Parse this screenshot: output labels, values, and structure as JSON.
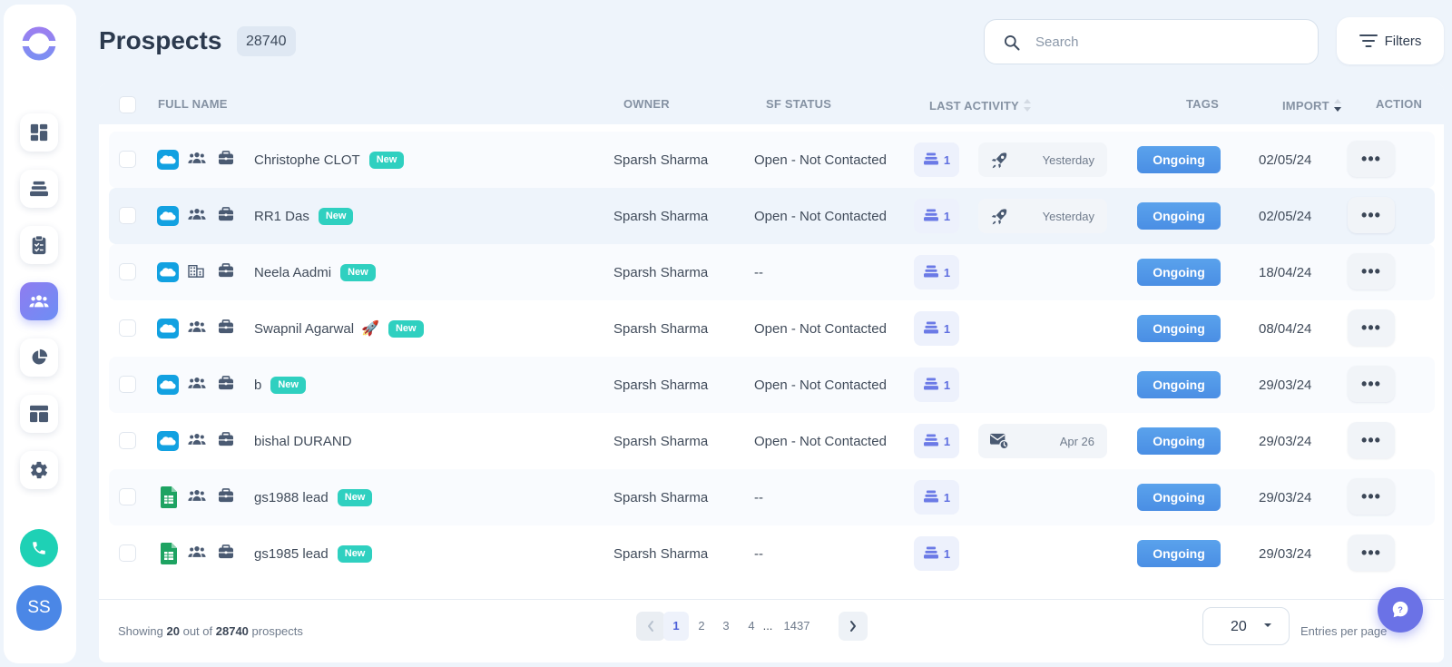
{
  "page": {
    "title": "Prospects",
    "total_count": "28740",
    "search_placeholder": "Search",
    "filters_label": "Filters"
  },
  "sidebar": {
    "items": [
      {
        "icon": "dashboard-icon",
        "active": false
      },
      {
        "icon": "sequences-icon",
        "active": false
      },
      {
        "icon": "tasks-icon",
        "active": false
      },
      {
        "icon": "prospects-icon",
        "active": true
      },
      {
        "icon": "reports-icon",
        "active": false
      },
      {
        "icon": "templates-icon",
        "active": false
      },
      {
        "icon": "settings-icon",
        "active": false
      }
    ],
    "phone_icon": "phone-icon",
    "avatar_initials": "SS"
  },
  "table": {
    "headers": {
      "full_name": "FULL NAME",
      "owner": "OWNER",
      "sf_status": "SF STATUS",
      "last_activity": "LAST ACTIVITY",
      "tags": "TAGS",
      "import": "IMPORT",
      "action": "ACTION"
    },
    "rows": [
      {
        "source": "salesforce",
        "type": "people",
        "name": "Christophe CLOT",
        "rocket": false,
        "badge": "New",
        "owner": "Sparsh Sharma",
        "sf_status": "Open - Not Contacted",
        "sequences": "1",
        "activity_icon": "rocket",
        "activity": "Yesterday",
        "tag": "Ongoing",
        "import": "02/05/24",
        "action": "•••"
      },
      {
        "source": "salesforce",
        "type": "people",
        "name": "RR1 Das",
        "rocket": false,
        "badge": "New",
        "owner": "Sparsh Sharma",
        "sf_status": "Open - Not Contacted",
        "sequences": "1",
        "activity_icon": "rocket",
        "activity": "Yesterday",
        "tag": "Ongoing",
        "import": "02/05/24",
        "action": "•••"
      },
      {
        "source": "salesforce",
        "type": "building",
        "name": "Neela Aadmi",
        "rocket": false,
        "badge": "New",
        "owner": "Sparsh Sharma",
        "sf_status": "--",
        "sequences": "1",
        "activity_icon": "",
        "activity": "",
        "tag": "Ongoing",
        "import": "18/04/24",
        "action": "•••"
      },
      {
        "source": "salesforce",
        "type": "people",
        "name": "Swapnil Agarwal",
        "rocket": true,
        "badge": "New",
        "owner": "Sparsh Sharma",
        "sf_status": "Open - Not Contacted",
        "sequences": "1",
        "activity_icon": "",
        "activity": "",
        "tag": "Ongoing",
        "import": "08/04/24",
        "action": "•••"
      },
      {
        "source": "salesforce",
        "type": "people",
        "name": "b",
        "rocket": false,
        "badge": "New",
        "owner": "Sparsh Sharma",
        "sf_status": "Open - Not Contacted",
        "sequences": "1",
        "activity_icon": "",
        "activity": "",
        "tag": "Ongoing",
        "import": "29/03/24",
        "action": "•••"
      },
      {
        "source": "salesforce",
        "type": "people",
        "name": "bishal DURAND",
        "rocket": false,
        "badge": "",
        "owner": "Sparsh Sharma",
        "sf_status": "Open - Not Contacted",
        "sequences": "1",
        "activity_icon": "mail",
        "activity": "Apr 26",
        "tag": "Ongoing",
        "import": "29/03/24",
        "action": "•••"
      },
      {
        "source": "sheets",
        "type": "people",
        "name": "gs1988 lead",
        "rocket": false,
        "badge": "New",
        "owner": "Sparsh Sharma",
        "sf_status": "--",
        "sequences": "1",
        "activity_icon": "",
        "activity": "",
        "tag": "Ongoing",
        "import": "29/03/24",
        "action": "•••"
      },
      {
        "source": "sheets",
        "type": "people",
        "name": "gs1985 lead",
        "rocket": false,
        "badge": "New",
        "owner": "Sparsh Sharma",
        "sf_status": "--",
        "sequences": "1",
        "activity_icon": "",
        "activity": "",
        "tag": "Ongoing",
        "import": "29/03/24",
        "action": "•••"
      }
    ]
  },
  "footer": {
    "showing_prefix": "Showing",
    "showing_count": "20",
    "showing_mid": "out of",
    "showing_total": "28740",
    "showing_suffix": "prospects",
    "pages": [
      "1",
      "2",
      "3",
      "4"
    ],
    "ellipsis": "...",
    "last_page": "1437",
    "active_page": "1",
    "per_page": "20",
    "per_page_label": "Entries per page"
  },
  "colors": {
    "accent": "#6b72e6",
    "tag": "#4a8ee4",
    "new_badge": "#2fd0c0",
    "salesforce": "#12a1e1",
    "sheets": "#1ea362"
  }
}
